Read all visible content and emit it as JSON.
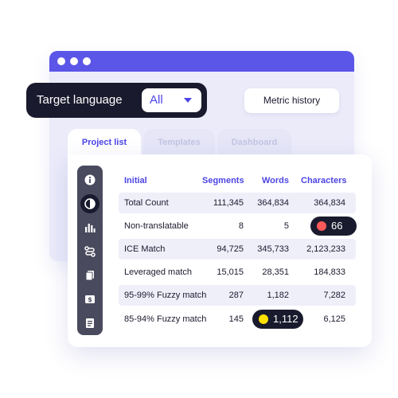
{
  "colors": {
    "accent": "#4c45e6",
    "dark": "#1a1a2e",
    "titlebar": "#5b55e8",
    "row_shade": "#efeffa",
    "badge_red": "#ff5a5a",
    "badge_yellow": "#ffe100"
  },
  "filter": {
    "label": "Target language",
    "value": "All"
  },
  "metric_history": {
    "label": "Metric history"
  },
  "tabs": [
    {
      "label": "Project list",
      "active": true
    },
    {
      "label": "Templates",
      "active": false
    },
    {
      "label": "Dashboard",
      "active": false
    }
  ],
  "sidebar": {
    "icons": [
      "info-icon",
      "pie-chart-icon",
      "bar-chart-icon",
      "route-icon",
      "documents-icon",
      "dollar-icon",
      "report-icon"
    ],
    "active": "pie-chart-icon"
  },
  "table": {
    "headers": [
      "Initial",
      "Segments",
      "Words",
      "Characters"
    ],
    "rows": [
      {
        "name": "Total Count",
        "segments": "111,345",
        "words": "364,834",
        "characters": "364,834"
      },
      {
        "name": "Non-translatable",
        "segments": "8",
        "words": "5",
        "characters": "66"
      },
      {
        "name": "ICE Match",
        "segments": "94,725",
        "words": "345,733",
        "characters": "2,123,233"
      },
      {
        "name": "Leveraged match",
        "segments": "15,015",
        "words": "28,351",
        "characters": "184,833"
      },
      {
        "name": "95-99% Fuzzy match",
        "segments": "287",
        "words": "1,182",
        "characters": "7,282"
      },
      {
        "name": "85-94% Fuzzy match",
        "segments": "145",
        "words": "1,112",
        "characters": "6,125"
      }
    ]
  }
}
